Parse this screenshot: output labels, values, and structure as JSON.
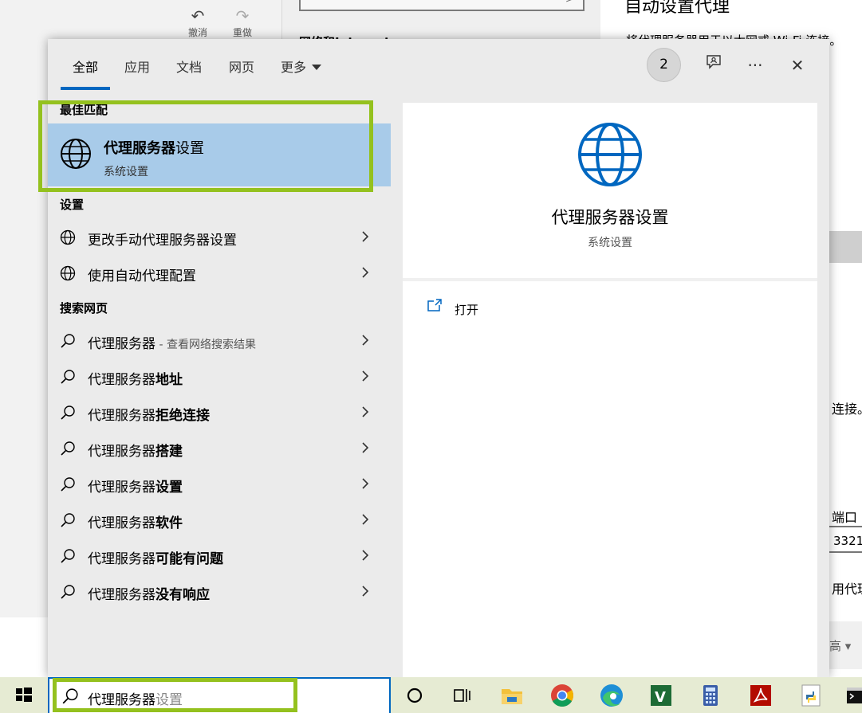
{
  "background": {
    "undo_label": "撤消",
    "redo_label": "重做",
    "mid_box_glyph": ">",
    "mid_label": "网络和Internet",
    "right_title": "自动设置代理",
    "right_text": "将代理服务器用于以太网或 Wi-Fi 连接。",
    "right_frag_connect": "连接。",
    "right_frag_port": "端口",
    "right_port_value": "3321",
    "right_frag_proxy": "用代理",
    "right_drop_text": "高 ▾"
  },
  "tabs": [
    {
      "label": "全部"
    },
    {
      "label": "应用"
    },
    {
      "label": "文档"
    },
    {
      "label": "网页"
    },
    {
      "label": "更多"
    }
  ],
  "top_bar": {
    "badge_count": "2",
    "more_options_glyph": "···",
    "close_glyph": "✕"
  },
  "best_match": {
    "section": "最佳匹配",
    "title_bold": "代理服务器",
    "title_rest": "设置",
    "subtitle": "系统设置"
  },
  "settings": {
    "section": "设置",
    "items": [
      {
        "label": "更改手动代理服务器设置"
      },
      {
        "label": "使用自动代理配置"
      }
    ]
  },
  "web_search": {
    "section": "搜索网页",
    "items": [
      {
        "base": "代理服务器",
        "bold": "",
        "hint": " - 查看网络搜索结果"
      },
      {
        "base": "代理服务器",
        "bold": "地址",
        "hint": ""
      },
      {
        "base": "代理服务器",
        "bold": "拒绝连接",
        "hint": ""
      },
      {
        "base": "代理服务器",
        "bold": "搭建",
        "hint": ""
      },
      {
        "base": "代理服务器",
        "bold": "设置",
        "hint": ""
      },
      {
        "base": "代理服务器",
        "bold": "软件",
        "hint": ""
      },
      {
        "base": "代理服务器",
        "bold": "可能有问题",
        "hint": ""
      },
      {
        "base": "代理服务器",
        "bold": "没有响应",
        "hint": ""
      }
    ]
  },
  "preview": {
    "title": "代理服务器设置",
    "subtitle": "系统设置",
    "open_label": "打开"
  },
  "taskbar": {
    "search_typed": "代理服务器",
    "search_ghost": "设置",
    "apps": [
      "cortana-icon",
      "task-view-icon",
      "file-explorer-icon",
      "chrome-icon",
      "edge-icon",
      "vim-icon",
      "calculator-icon",
      "acrobat-icon",
      "python-icon",
      "terminal-icon"
    ]
  },
  "colors": {
    "accent": "#0067c0",
    "highlight_green": "#94c11e",
    "selected_bg": "#a8cbe9"
  }
}
